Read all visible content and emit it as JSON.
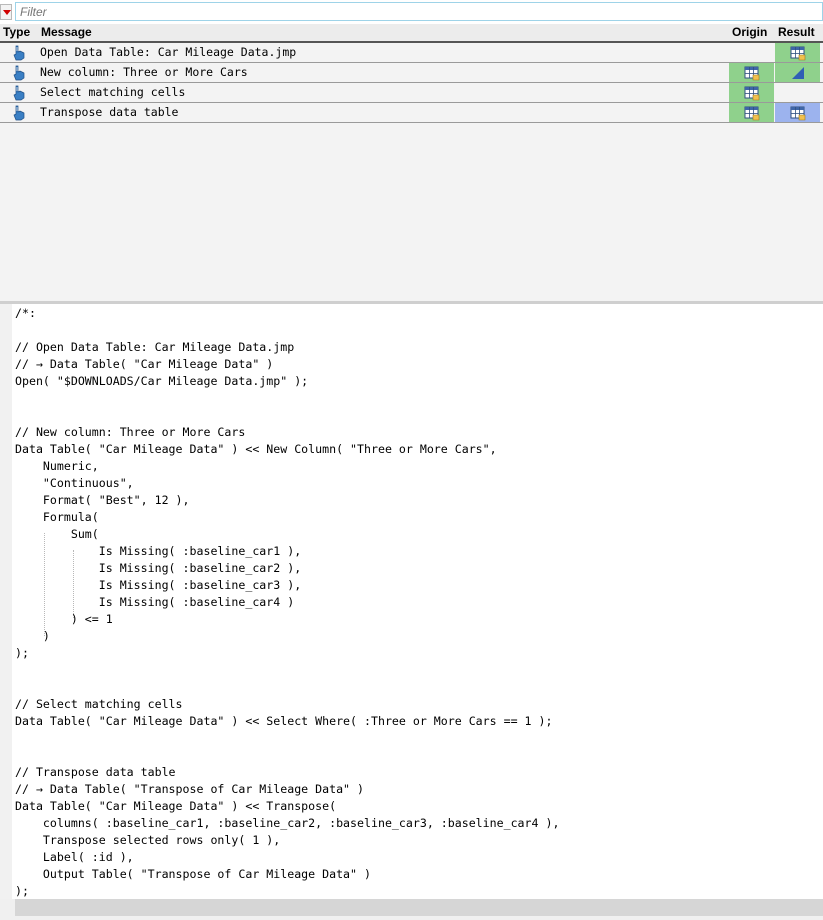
{
  "filter": {
    "placeholder": "Filter"
  },
  "columns": {
    "type": "Type",
    "message": "Message",
    "origin": "Origin",
    "result": "Result"
  },
  "log_rows": [
    {
      "message": "Open Data Table: Car Mileage Data.jmp",
      "origin_icon": "",
      "result_icon": "data-table-icon",
      "origin_color": "",
      "result_color": "#8fd18c"
    },
    {
      "message": "New column: Three or More Cars",
      "origin_icon": "data-table-icon",
      "result_icon": "column-continuous-icon",
      "origin_color": "#8fd18c",
      "result_color": "#8fd18c"
    },
    {
      "message": "Select matching cells",
      "origin_icon": "data-table-icon",
      "result_icon": "",
      "origin_color": "#8fd18c",
      "result_color": ""
    },
    {
      "message": "Transpose data table",
      "origin_icon": "data-table-icon",
      "result_icon": "data-table-icon",
      "origin_color": "#8fd18c",
      "result_color": "#9cb3ee"
    }
  ],
  "code": "/*:\n\n// Open Data Table: Car Mileage Data.jmp\n// → Data Table( \"Car Mileage Data\" )\nOpen( \"$DOWNLOADS/Car Mileage Data.jmp\" );\n\n\n// New column: Three or More Cars\nData Table( \"Car Mileage Data\" ) << New Column( \"Three or More Cars\",\n    Numeric,\n    \"Continuous\",\n    Format( \"Best\", 12 ),\n    Formula(\n        Sum(\n            Is Missing( :baseline_car1 ),\n            Is Missing( :baseline_car2 ),\n            Is Missing( :baseline_car3 ),\n            Is Missing( :baseline_car4 )\n        ) <= 1\n    )\n);\n\n\n// Select matching cells\nData Table( \"Car Mileage Data\" ) << Select Where( :Three or More Cars == 1 );\n\n\n// Transpose data table\n// → Data Table( \"Transpose of Car Mileage Data\" )\nData Table( \"Car Mileage Data\" ) << Transpose(\n    columns( :baseline_car1, :baseline_car2, :baseline_car3, :baseline_car4 ),\n    Transpose selected rows only( 1 ),\n    Label( :id ),\n    Output Table( \"Transpose of Car Mileage Data\" )\n);"
}
